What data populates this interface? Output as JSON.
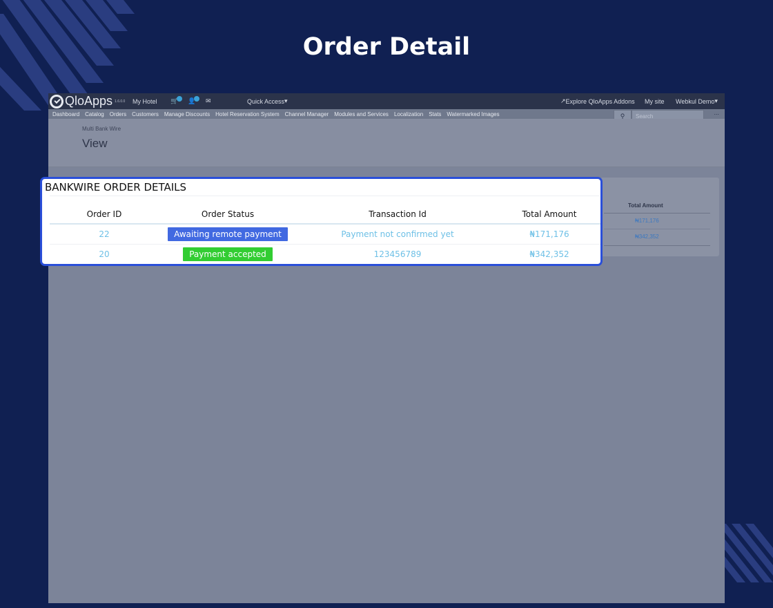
{
  "page": {
    "heading": "Order Detail"
  },
  "app": {
    "logo_text": "QloApps",
    "version": "1.6.0.0",
    "shop_name": "My Hotel",
    "quick_access": "Quick Access",
    "explore": "Explore QloApps Addons",
    "my_site": "My site",
    "user": "Webkul Demo"
  },
  "nav": {
    "items": [
      "Dashboard",
      "Catalog",
      "Orders",
      "Customers",
      "Manage Discounts",
      "Hotel Reservation System",
      "Channel Manager",
      "Modules and Services",
      "Localization",
      "Stats",
      "Watermarked Images"
    ],
    "search_placeholder": "Search",
    "more": "..."
  },
  "header": {
    "breadcrumb": "Multi Bank Wire",
    "title": "View"
  },
  "background_panel": {
    "column_header": "Total Amount",
    "amounts": [
      "₦171,176",
      "₦342,352"
    ]
  },
  "callout": {
    "title": "BANKWIRE ORDER DETAILS",
    "columns": [
      "Order ID",
      "Order Status",
      "Transaction Id",
      "Total Amount"
    ],
    "rows": [
      {
        "order_id": "22",
        "status": "Awaiting remote payment",
        "status_color": "#4169e1",
        "transaction_id": "Payment not confirmed yet",
        "total": "₦171,176"
      },
      {
        "order_id": "20",
        "status": "Payment accepted",
        "status_color": "#32cd32",
        "transaction_id": "123456789",
        "total": "₦342,352"
      }
    ]
  }
}
